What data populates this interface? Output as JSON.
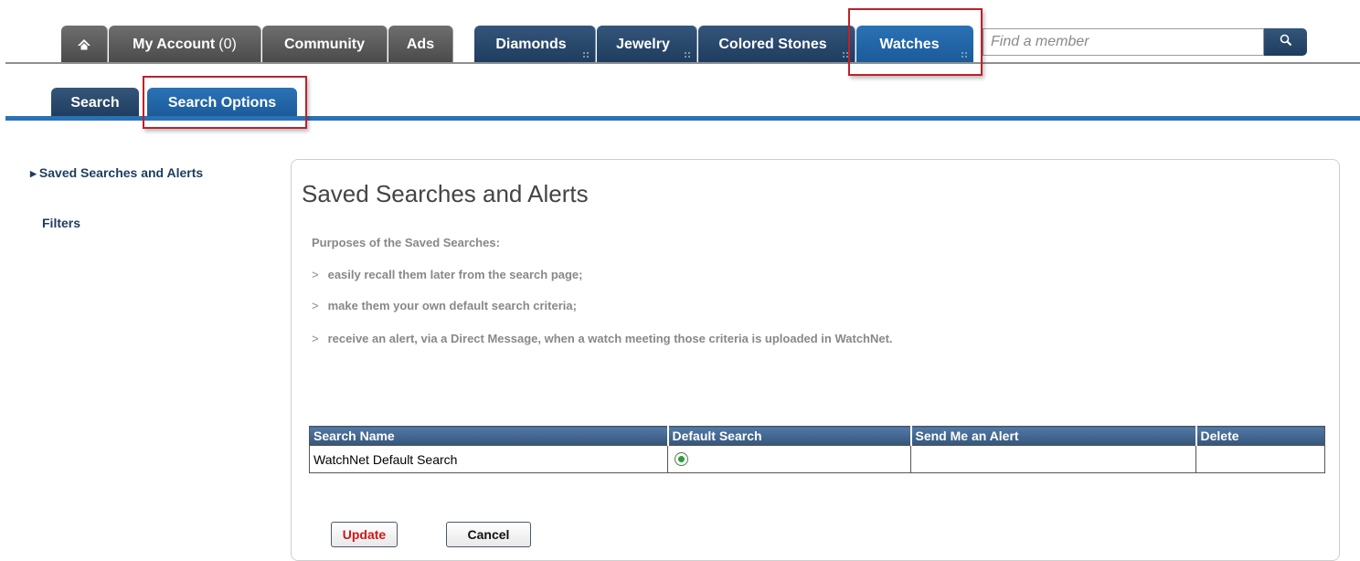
{
  "nav": {
    "home_icon": "home-icon",
    "my_account_label": "My Account",
    "my_account_count": "(0)",
    "community_label": "Community",
    "ads_label": "Ads",
    "diamonds_label": "Diamonds",
    "jewelry_label": "Jewelry",
    "colored_stones_label": "Colored Stones",
    "watches_label": "Watches"
  },
  "member_search": {
    "placeholder": "Find a member",
    "icon": "search-icon"
  },
  "subtabs": {
    "search_label": "Search",
    "search_options_label": "Search Options"
  },
  "sidebar": {
    "items": [
      {
        "label": "Saved Searches and Alerts",
        "active": true
      },
      {
        "label": "Filters",
        "active": false
      }
    ]
  },
  "main": {
    "title": "Saved Searches and Alerts",
    "intro": "Purposes of the Saved Searches:",
    "bullet_marker": ">",
    "bullets": [
      "easily recall them later from the search page;",
      "make them your own default search criteria;",
      "receive an alert, via a Direct Message, when a watch meeting those criteria is uploaded in WatchNet."
    ]
  },
  "table": {
    "headers": [
      "Search Name",
      "Default Search",
      "Send Me an Alert",
      "Delete"
    ],
    "rows": [
      {
        "name": "WatchNet Default Search",
        "default_selected": true
      }
    ]
  },
  "buttons": {
    "update_label": "Update",
    "cancel_label": "Cancel"
  },
  "colors": {
    "nav_dark_blue": "#1e3c5e",
    "nav_active_blue": "#2a72b6",
    "highlight_red": "#c0202a",
    "update_text_red": "#d01818"
  }
}
